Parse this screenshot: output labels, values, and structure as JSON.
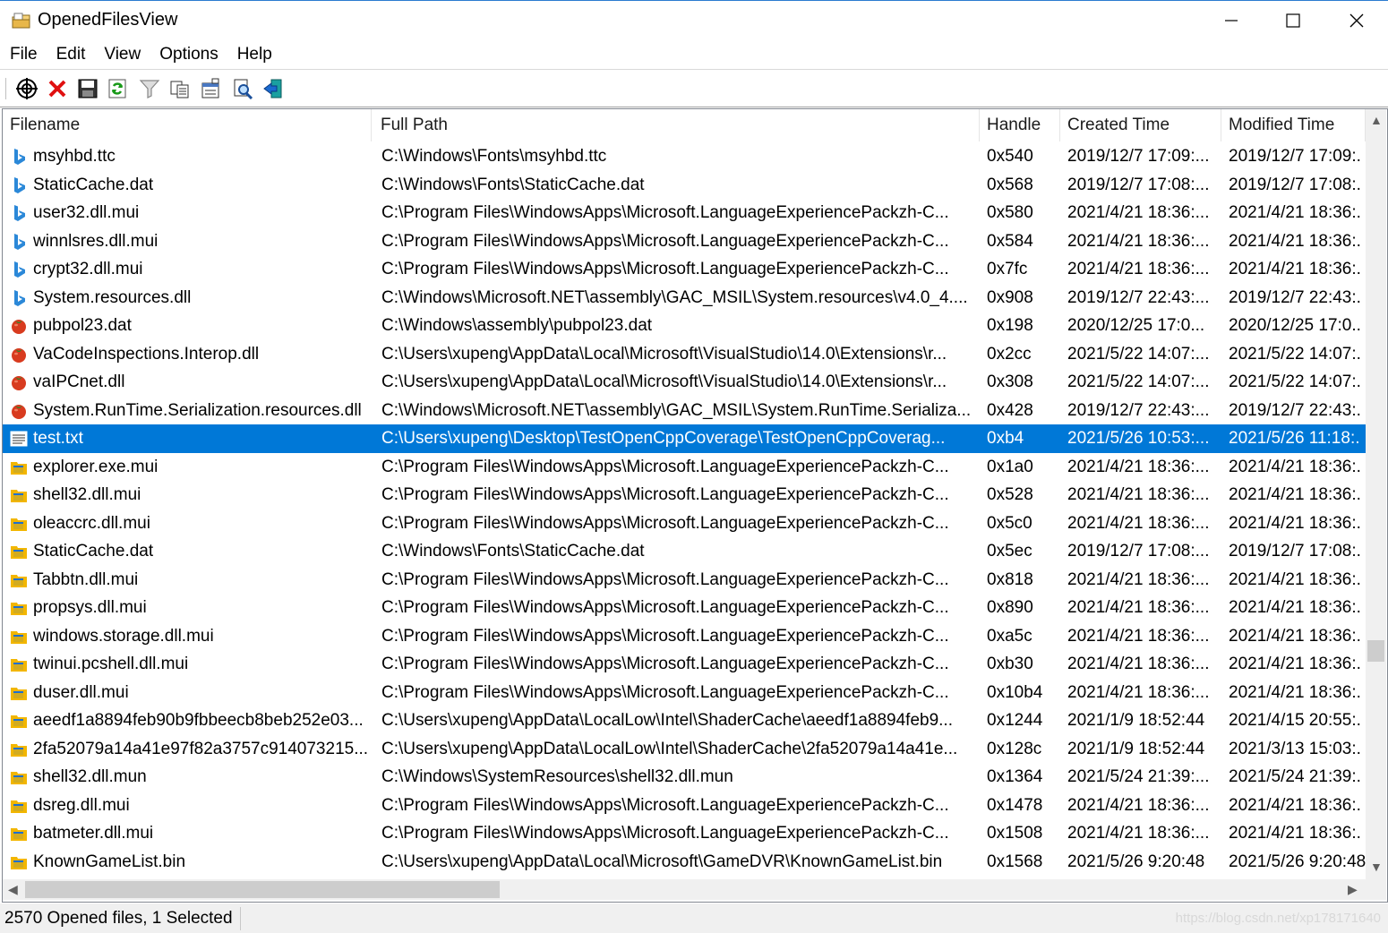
{
  "window": {
    "title": "OpenedFilesView"
  },
  "menu": [
    "File",
    "Edit",
    "View",
    "Options",
    "Help"
  ],
  "toolbar": [
    "properties-target-icon",
    "close-file-icon",
    "save-icon",
    "refresh-icon",
    "filter-icon",
    "copy-icon",
    "html-report-icon",
    "find-icon",
    "exit-icon"
  ],
  "columns": {
    "filename": "Filename",
    "fullpath": "Full Path",
    "handle": "Handle",
    "created": "Created Time",
    "modified": "Modified Time"
  },
  "rows": [
    {
      "icon": "bing",
      "filename": "msyhbd.ttc",
      "path": "C:\\Windows\\Fonts\\msyhbd.ttc",
      "handle": "0x540",
      "created": "2019/12/7 17:09:...",
      "modified": "2019/12/7 17:09:."
    },
    {
      "icon": "bing",
      "filename": "StaticCache.dat",
      "path": "C:\\Windows\\Fonts\\StaticCache.dat",
      "handle": "0x568",
      "created": "2019/12/7 17:08:...",
      "modified": "2019/12/7 17:08:."
    },
    {
      "icon": "bing",
      "filename": "user32.dll.mui",
      "path": "C:\\Program Files\\WindowsApps\\Microsoft.LanguageExperiencePackzh-C...",
      "handle": "0x580",
      "created": "2021/4/21 18:36:...",
      "modified": "2021/4/21 18:36:."
    },
    {
      "icon": "bing",
      "filename": "winnlsres.dll.mui",
      "path": "C:\\Program Files\\WindowsApps\\Microsoft.LanguageExperiencePackzh-C...",
      "handle": "0x584",
      "created": "2021/4/21 18:36:...",
      "modified": "2021/4/21 18:36:."
    },
    {
      "icon": "bing",
      "filename": "crypt32.dll.mui",
      "path": "C:\\Program Files\\WindowsApps\\Microsoft.LanguageExperiencePackzh-C...",
      "handle": "0x7fc",
      "created": "2021/4/21 18:36:...",
      "modified": "2021/4/21 18:36:."
    },
    {
      "icon": "bing",
      "filename": "System.resources.dll",
      "path": "C:\\Windows\\Microsoft.NET\\assembly\\GAC_MSIL\\System.resources\\v4.0_4....",
      "handle": "0x908",
      "created": "2019/12/7 22:43:...",
      "modified": "2019/12/7 22:43:."
    },
    {
      "icon": "tomato",
      "filename": "pubpol23.dat",
      "path": "C:\\Windows\\assembly\\pubpol23.dat",
      "handle": "0x198",
      "created": "2020/12/25 17:0...",
      "modified": "2020/12/25 17:0.."
    },
    {
      "icon": "tomato",
      "filename": "VaCodeInspections.Interop.dll",
      "path": "C:\\Users\\xupeng\\AppData\\Local\\Microsoft\\VisualStudio\\14.0\\Extensions\\r...",
      "handle": "0x2cc",
      "created": "2021/5/22 14:07:...",
      "modified": "2021/5/22 14:07:."
    },
    {
      "icon": "tomato",
      "filename": "vaIPCnet.dll",
      "path": "C:\\Users\\xupeng\\AppData\\Local\\Microsoft\\VisualStudio\\14.0\\Extensions\\r...",
      "handle": "0x308",
      "created": "2021/5/22 14:07:...",
      "modified": "2021/5/22 14:07:."
    },
    {
      "icon": "tomato",
      "filename": "System.RunTime.Serialization.resources.dll",
      "path": "C:\\Windows\\Microsoft.NET\\assembly\\GAC_MSIL\\System.RunTime.Serializa...",
      "handle": "0x428",
      "created": "2019/12/7 22:43:...",
      "modified": "2019/12/7 22:43:."
    },
    {
      "icon": "textfile",
      "filename": "test.txt",
      "path": "C:\\Users\\xupeng\\Desktop\\TestOpenCppCoverage\\TestOpenCppCoverag...",
      "handle": "0xb4",
      "created": "2021/5/26 10:53:...",
      "modified": "2021/5/26 11:18:.",
      "selected": true
    },
    {
      "icon": "folder",
      "filename": "explorer.exe.mui",
      "path": "C:\\Program Files\\WindowsApps\\Microsoft.LanguageExperiencePackzh-C...",
      "handle": "0x1a0",
      "created": "2021/4/21 18:36:...",
      "modified": "2021/4/21 18:36:."
    },
    {
      "icon": "folder",
      "filename": "shell32.dll.mui",
      "path": "C:\\Program Files\\WindowsApps\\Microsoft.LanguageExperiencePackzh-C...",
      "handle": "0x528",
      "created": "2021/4/21 18:36:...",
      "modified": "2021/4/21 18:36:."
    },
    {
      "icon": "folder",
      "filename": "oleaccrc.dll.mui",
      "path": "C:\\Program Files\\WindowsApps\\Microsoft.LanguageExperiencePackzh-C...",
      "handle": "0x5c0",
      "created": "2021/4/21 18:36:...",
      "modified": "2021/4/21 18:36:."
    },
    {
      "icon": "folder",
      "filename": "StaticCache.dat",
      "path": "C:\\Windows\\Fonts\\StaticCache.dat",
      "handle": "0x5ec",
      "created": "2019/12/7 17:08:...",
      "modified": "2019/12/7 17:08:."
    },
    {
      "icon": "folder",
      "filename": "Tabbtn.dll.mui",
      "path": "C:\\Program Files\\WindowsApps\\Microsoft.LanguageExperiencePackzh-C...",
      "handle": "0x818",
      "created": "2021/4/21 18:36:...",
      "modified": "2021/4/21 18:36:."
    },
    {
      "icon": "folder",
      "filename": "propsys.dll.mui",
      "path": "C:\\Program Files\\WindowsApps\\Microsoft.LanguageExperiencePackzh-C...",
      "handle": "0x890",
      "created": "2021/4/21 18:36:...",
      "modified": "2021/4/21 18:36:."
    },
    {
      "icon": "folder",
      "filename": "windows.storage.dll.mui",
      "path": "C:\\Program Files\\WindowsApps\\Microsoft.LanguageExperiencePackzh-C...",
      "handle": "0xa5c",
      "created": "2021/4/21 18:36:...",
      "modified": "2021/4/21 18:36:."
    },
    {
      "icon": "folder",
      "filename": "twinui.pcshell.dll.mui",
      "path": "C:\\Program Files\\WindowsApps\\Microsoft.LanguageExperiencePackzh-C...",
      "handle": "0xb30",
      "created": "2021/4/21 18:36:...",
      "modified": "2021/4/21 18:36:."
    },
    {
      "icon": "folder",
      "filename": "duser.dll.mui",
      "path": "C:\\Program Files\\WindowsApps\\Microsoft.LanguageExperiencePackzh-C...",
      "handle": "0x10b4",
      "created": "2021/4/21 18:36:...",
      "modified": "2021/4/21 18:36:."
    },
    {
      "icon": "folder",
      "filename": "aeedf1a8894feb90b9fbbeecb8beb252e03...",
      "path": "C:\\Users\\xupeng\\AppData\\LocalLow\\Intel\\ShaderCache\\aeedf1a8894feb9...",
      "handle": "0x1244",
      "created": "2021/1/9 18:52:44",
      "modified": "2021/4/15 20:55:."
    },
    {
      "icon": "folder",
      "filename": "2fa52079a14a41e97f82a3757c914073215...",
      "path": "C:\\Users\\xupeng\\AppData\\LocalLow\\Intel\\ShaderCache\\2fa52079a14a41e...",
      "handle": "0x128c",
      "created": "2021/1/9 18:52:44",
      "modified": "2021/3/13 15:03:."
    },
    {
      "icon": "folder",
      "filename": "shell32.dll.mun",
      "path": "C:\\Windows\\SystemResources\\shell32.dll.mun",
      "handle": "0x1364",
      "created": "2021/5/24 21:39:...",
      "modified": "2021/5/24 21:39:."
    },
    {
      "icon": "folder",
      "filename": "dsreg.dll.mui",
      "path": "C:\\Program Files\\WindowsApps\\Microsoft.LanguageExperiencePackzh-C...",
      "handle": "0x1478",
      "created": "2021/4/21 18:36:...",
      "modified": "2021/4/21 18:36:."
    },
    {
      "icon": "folder",
      "filename": "batmeter.dll.mui",
      "path": "C:\\Program Files\\WindowsApps\\Microsoft.LanguageExperiencePackzh-C...",
      "handle": "0x1508",
      "created": "2021/4/21 18:36:...",
      "modified": "2021/4/21 18:36:."
    },
    {
      "icon": "folder",
      "filename": "KnownGameList.bin",
      "path": "C:\\Users\\xupeng\\AppData\\Local\\Microsoft\\GameDVR\\KnownGameList.bin",
      "handle": "0x1568",
      "created": "2021/5/26 9:20:48",
      "modified": "2021/5/26 9:20:48"
    }
  ],
  "status": {
    "text": "2570 Opened files, 1 Selected",
    "watermark": "https://blog.csdn.net/xp178171640"
  },
  "colors": {
    "selection": "#0078d7",
    "bing": "#2b88d8",
    "folder": "#f2b600",
    "tomato": "#d83b1f"
  }
}
